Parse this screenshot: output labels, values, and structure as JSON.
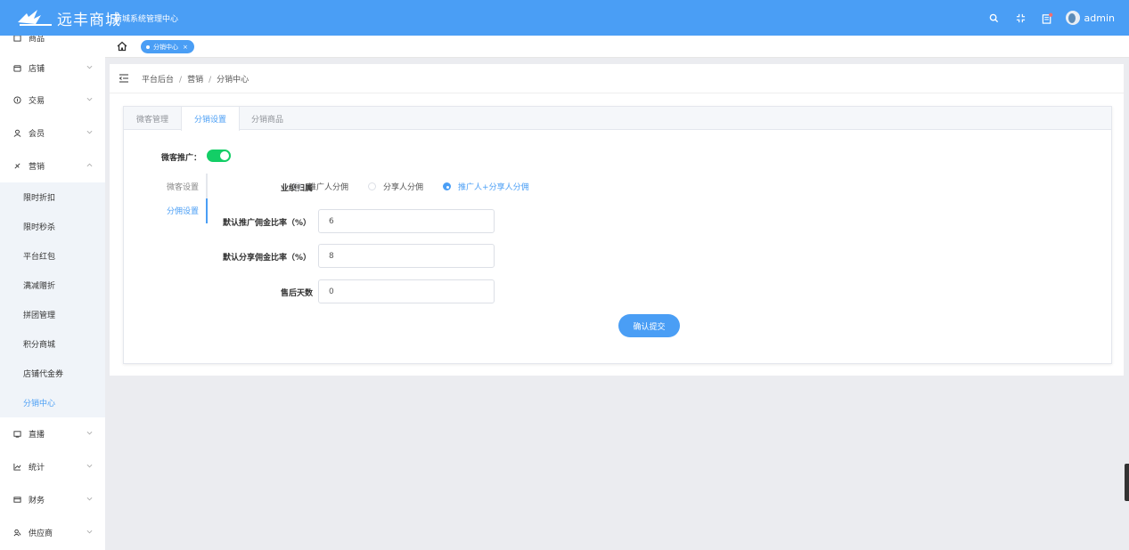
{
  "header": {
    "logo_text": "远丰商城",
    "system_title": "商城系统管理中心",
    "user": "admin",
    "icons": [
      "search-icon",
      "fullscreen-icon",
      "notification-icon"
    ]
  },
  "sidebar": {
    "top_partial": "商品",
    "items": [
      {
        "label": "店铺",
        "icon": "store-icon"
      },
      {
        "label": "交易",
        "icon": "trade-icon"
      },
      {
        "label": "会员",
        "icon": "member-icon"
      },
      {
        "label": "营销",
        "icon": "marketing-icon"
      }
    ],
    "sub_items": [
      "限时折扣",
      "限时秒杀",
      "平台红包",
      "满减赠折",
      "拼团管理",
      "积分商城",
      "店铺代金券",
      "分销中心"
    ],
    "active_sub": "分销中心",
    "bottom_items": [
      {
        "label": "直播",
        "icon": "live-icon"
      },
      {
        "label": "统计",
        "icon": "stats-icon"
      },
      {
        "label": "财务",
        "icon": "finance-icon"
      },
      {
        "label": "供应商",
        "icon": "supplier-icon"
      }
    ]
  },
  "tags": {
    "active_tag": "分销中心",
    "close": "×"
  },
  "breadcrumb": [
    "平台后台",
    "营销",
    "分销中心"
  ],
  "tabs": [
    "微客管理",
    "分销设置",
    "分销商品"
  ],
  "active_tab": "分销设置",
  "promo": {
    "label": "微客推广：",
    "enabled": true
  },
  "vertical_tabs": [
    "微客设置",
    "分佣设置"
  ],
  "active_vertical_tab": "分佣设置",
  "form": {
    "attribution_label": "业绩归属",
    "attribution_options": [
      "推广人分佣",
      "分享人分佣",
      "推广人+分享人分佣"
    ],
    "attribution_selected": "推广人+分享人分佣",
    "promo_rate_label": "默认推广佣金比率（%）",
    "promo_rate_value": "6",
    "share_rate_label": "默认分享佣金比率（%）",
    "share_rate_value": "8",
    "aftersale_days_label": "售后天数",
    "aftersale_days_value": "0",
    "submit_label": "确认提交"
  },
  "colors": {
    "primary": "#4a9ef5",
    "switch_on": "#13ce66"
  }
}
